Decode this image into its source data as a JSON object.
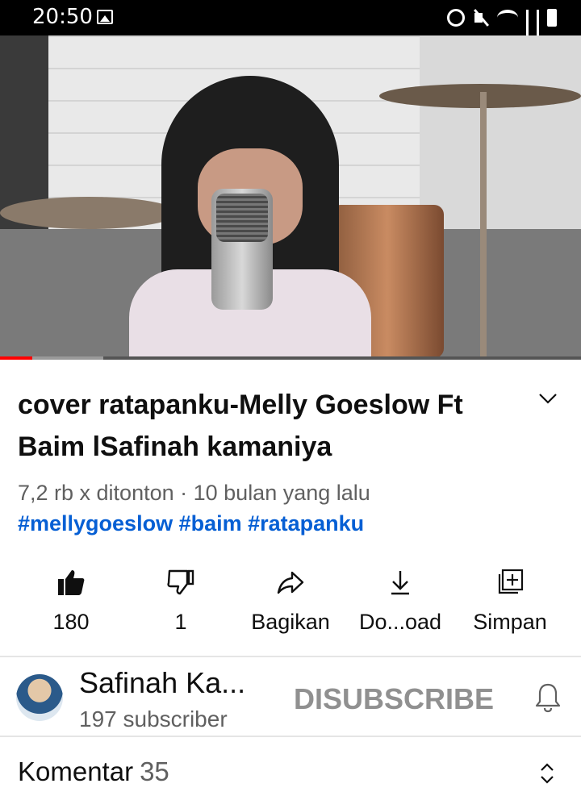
{
  "status_bar": {
    "time": "20:50",
    "icons": [
      "image-icon",
      "alarm-icon",
      "mute-icon",
      "wifi-icon",
      "signal-icon",
      "signal-icon",
      "battery-icon"
    ]
  },
  "video": {
    "progress_played_fraction": 0.055,
    "progress_buffered_fraction": 0.178,
    "accent_color": "#ff0000"
  },
  "title": "cover ratapanku-Melly Goeslow Ft Baim lSafinah kamaniya",
  "meta": "7,2 rb x ditonton · 10 bulan yang lalu",
  "hashtags": "#mellygoeslow #baim #ratapanku",
  "actions": {
    "like": "180",
    "dislike": "1",
    "share": "Bagikan",
    "download": "Do...oad",
    "save": "Simpan"
  },
  "channel": {
    "name": "Safinah Ka...",
    "subscribers": "197 subscriber",
    "subscribe_button": "DISUBSCRIBE"
  },
  "comments": {
    "label": "Komentar",
    "count": "35"
  },
  "colors": {
    "link": "#065fd4",
    "secondary_text": "#606060",
    "subscribed_button": "#909090"
  }
}
